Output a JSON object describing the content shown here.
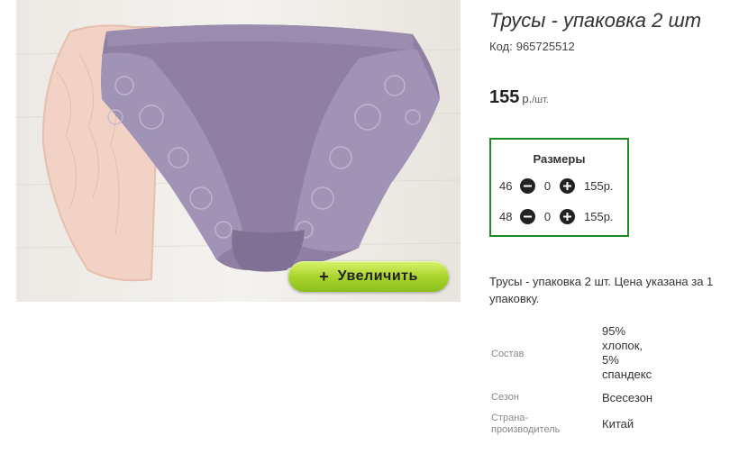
{
  "product": {
    "title": "Трусы - упаковка 2 шт",
    "sku_label": "Код:",
    "sku_value": "965725512",
    "price": "155",
    "currency": "р.",
    "unit": "/шт.",
    "zoom_label": "Увеличить"
  },
  "sizes": {
    "title": "Размеры",
    "rows": [
      {
        "size": "46",
        "qty": "0",
        "price": "155р."
      },
      {
        "size": "48",
        "qty": "0",
        "price": "155р."
      }
    ]
  },
  "description": "Трусы - упаковка 2 шт. Цена указана за 1 упаковку.",
  "specs": [
    {
      "key": "Состав",
      "value_lines": [
        "95%",
        "хлопок,",
        "5%",
        "спандекс"
      ]
    },
    {
      "key": "Сезон",
      "value_lines": [
        "Всесезон"
      ]
    },
    {
      "key_lines": [
        "Страна-",
        "производитель"
      ],
      "value_lines": [
        "Китай"
      ]
    }
  ],
  "colors": {
    "sizes_border": "#1f8a1f",
    "zoom_button": "#a6d12a",
    "garment": "#8e7fa3",
    "lace": "#a596b8",
    "second_garment": "#f0cfc0"
  }
}
